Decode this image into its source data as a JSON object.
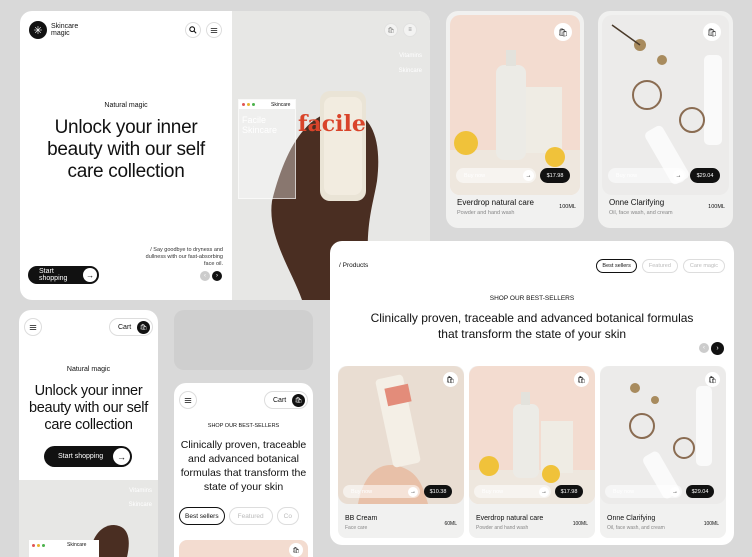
{
  "brand": {
    "name_line1": "Skincare",
    "name_line2": "magic"
  },
  "hero": {
    "eyebrow": "Natural magic",
    "title_line1": "Unlock your inner",
    "title_line2": "beauty with our self",
    "title_line3": "care collection",
    "cta": "Start shopping",
    "blurb_line1": "/ Say goodbye to dryness and",
    "blurb_line2": "dullness with our fast-absorbing",
    "blurb_line3": "face oil.",
    "side_links": [
      "Vitamins",
      "Skincare"
    ],
    "bottle_label": "facile",
    "mini_window_title": "Skincare",
    "mini_window_text_1": "Facile",
    "mini_window_text_2": "Skincare"
  },
  "mobile": {
    "cart_label": "Cart",
    "cart_label_2": "Cart"
  },
  "products_section": {
    "breadcrumb": "/ Products",
    "filters": [
      "Best sellers",
      "Featured",
      "Care magic"
    ],
    "eyebrow": "SHOP OUR BEST-SELLERS",
    "title_line1": "Clinically proven, traceable and advanced botanical formulas",
    "title_line2": "that transform the state of your skin"
  },
  "mobile_products": {
    "eyebrow": "SHOP OUR BEST-SELLERS",
    "title_line1": "Clinically proven, traceable",
    "title_line2": "and advanced botanical",
    "title_line3": "formulas that transform the",
    "title_line4": "state of your skin",
    "filters": [
      "Best sellers",
      "Featured",
      "Co"
    ]
  },
  "products": [
    {
      "name": "BB Cream",
      "desc": "Face care",
      "size": "60ML",
      "price": "$10.38",
      "buy": "Buy now"
    },
    {
      "name": "Everdrop natural care",
      "desc": "Powder and hand wash",
      "size": "100ML",
      "price": "$17.98",
      "buy": "Buy now"
    },
    {
      "name": "Onne Clarifying",
      "desc": "Oil, face wash, and cream",
      "size": "100ML",
      "price": "$29.04",
      "buy": "Buy now"
    }
  ],
  "colors": {
    "dark": "#111111",
    "peach": "#f3dcd0",
    "bg": "#d9d9d9",
    "accent_red": "#d9442a"
  }
}
